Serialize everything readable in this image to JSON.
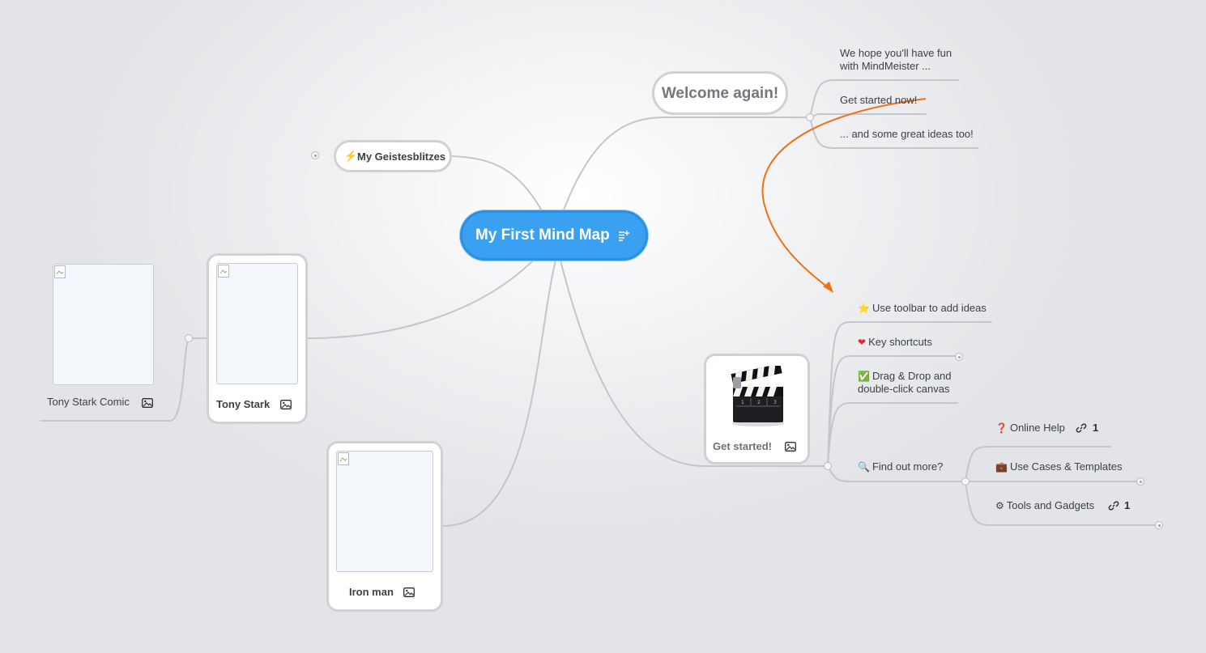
{
  "central": {
    "label": "My First Mind Map"
  },
  "welcome": {
    "label": "Welcome again!",
    "children": [
      "We hope you'll have fun",
      "with MindMeister ...",
      "Get started now!",
      "... and some great ideas too!"
    ]
  },
  "geistesblitzes": {
    "icon": "lightning-icon",
    "label": "My Geistesblitzes"
  },
  "tony_stark": {
    "label": "Tony Stark"
  },
  "tony_stark_comic": {
    "label": "Tony Stark Comic"
  },
  "iron_man": {
    "label": "Iron man"
  },
  "get_started": {
    "label": "Get started!",
    "children": [
      {
        "icon": "star-icon",
        "label": "Use toolbar to add ideas"
      },
      {
        "icon": "heart-icon",
        "label": "Key shortcuts"
      },
      {
        "icon": "check-icon",
        "label1": "Drag & Drop and",
        "label2": "double-click canvas"
      },
      {
        "icon": "magnifier-icon",
        "label": "Find out more?"
      }
    ]
  },
  "find_out_more": {
    "children": [
      {
        "icon": "question-icon",
        "label": "Online Help",
        "link_count": "1"
      },
      {
        "icon": "briefcase-icon",
        "label": "Use Cases & Templates"
      },
      {
        "icon": "gear-icon",
        "label": "Tools and Gadgets",
        "link_count": "1"
      }
    ]
  },
  "colors": {
    "accent": "#3aa0f2",
    "connector": "#f07012",
    "branch": "#c2c4c7"
  }
}
